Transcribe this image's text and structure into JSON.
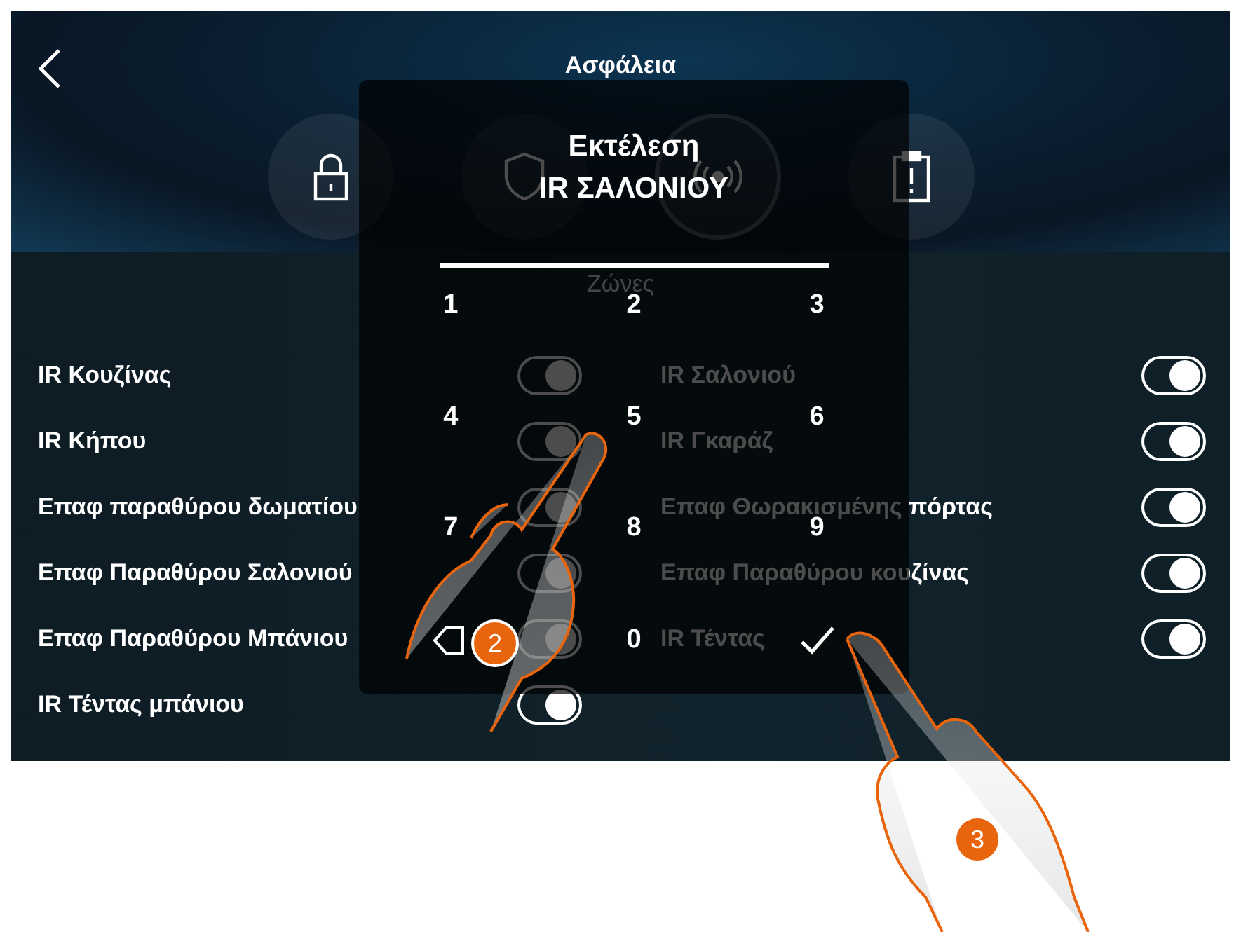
{
  "header": {
    "title": "Ασφάλεια"
  },
  "zones": {
    "title": "Ζώνες",
    "items": [
      {
        "name": "IR Κουζίνας",
        "on": true
      },
      {
        "name": "IR Σαλονιού",
        "on": true
      },
      {
        "name": "IR Κήπου",
        "on": true
      },
      {
        "name": "IR Γκαράζ",
        "on": true
      },
      {
        "name": "Επαφ παραθύρου δωματίου",
        "on": true
      },
      {
        "name": "Επαφ Θωρακισμένης πόρτας",
        "on": true
      },
      {
        "name": "Επαφ Παραθύρου Σαλονιού",
        "on": true
      },
      {
        "name": "Επαφ Παραθύρου κουζίνας",
        "on": true
      },
      {
        "name": "Επαφ Παραθύρου Μπάνιου",
        "on": true
      },
      {
        "name": "IR Τέντας",
        "on": true
      },
      {
        "name": "IR Τέντας μπάνιου",
        "on": true
      }
    ]
  },
  "dialog": {
    "title": [
      "Εκτέλεση",
      "IR ΣΑΛΟΝΙΟΥ"
    ],
    "keys": [
      {
        "kind": "digit",
        "label": "1"
      },
      {
        "kind": "digit",
        "label": "2"
      },
      {
        "kind": "digit",
        "label": "3"
      },
      {
        "kind": "digit",
        "label": "4"
      },
      {
        "kind": "digit",
        "label": "5"
      },
      {
        "kind": "digit",
        "label": "6"
      },
      {
        "kind": "digit",
        "label": "7"
      },
      {
        "kind": "digit",
        "label": "8"
      },
      {
        "kind": "digit",
        "label": "9"
      },
      {
        "kind": "backspace"
      },
      {
        "kind": "digit",
        "label": "0"
      },
      {
        "kind": "confirm"
      }
    ]
  },
  "callouts": [
    {
      "label": "2"
    },
    {
      "label": "3"
    }
  ]
}
